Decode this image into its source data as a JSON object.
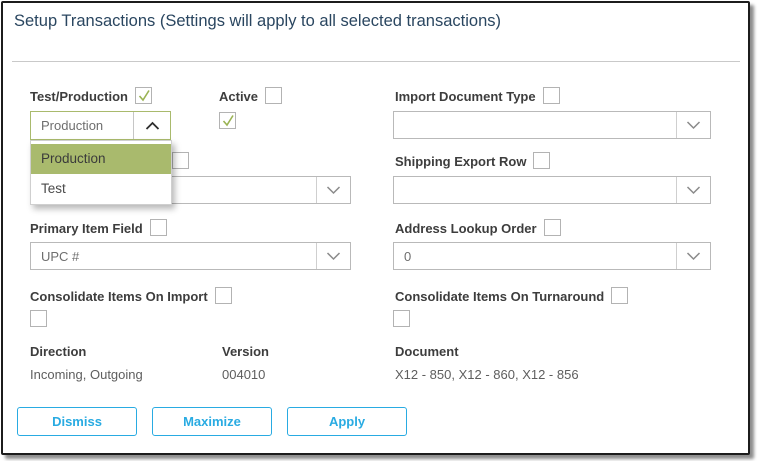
{
  "title": "Setup Transactions (Settings will apply to all selected transactions)",
  "form": {
    "test_production": {
      "label": "Test/Production",
      "label_checkbox_checked": true,
      "value": "Production",
      "dropdown_open": true,
      "options": [
        "Production",
        "Test"
      ],
      "highlighted_option": "Production"
    },
    "active": {
      "label": "Active",
      "label_checkbox_checked": false,
      "value_checkbox_checked": true
    },
    "import_document_type": {
      "label": "Import Document Type",
      "label_checkbox_checked": false,
      "value": ""
    },
    "shipping_export_row": {
      "label": "Shipping Export Row",
      "label_checkbox_checked": false,
      "value": ""
    },
    "obscured_field": {
      "label_checkbox_checked": false,
      "value": ""
    },
    "primary_item_field": {
      "label": "Primary Item Field",
      "label_checkbox_checked": false,
      "value": "UPC #"
    },
    "address_lookup_order": {
      "label": "Address Lookup Order",
      "label_checkbox_checked": false,
      "value": "0"
    },
    "consolidate_items_on_import": {
      "label": "Consolidate Items On Import",
      "label_checkbox_checked": false,
      "value_checkbox_checked": false
    },
    "consolidate_items_on_turnaround": {
      "label": "Consolidate Items On Turnaround",
      "label_checkbox_checked": false,
      "value_checkbox_checked": false
    }
  },
  "summary": {
    "direction": {
      "label": "Direction",
      "value": "Incoming, Outgoing"
    },
    "version": {
      "label": "Version",
      "value": "004010"
    },
    "document": {
      "label": "Document",
      "value": "X12 - 850, X12 - 860, X12 - 856"
    }
  },
  "buttons": {
    "dismiss": "Dismiss",
    "maximize": "Maximize",
    "apply": "Apply"
  },
  "icons": {
    "check_icon": "✓",
    "chevron_up_icon": "^",
    "chevron_down_icon": "v"
  },
  "colors": {
    "accent_blue": "#29abe2",
    "olive_highlight": "#a9ba6d",
    "check_green": "#9ab353",
    "title_text": "#2a4660",
    "dialog_border": "#1c1c1c"
  }
}
